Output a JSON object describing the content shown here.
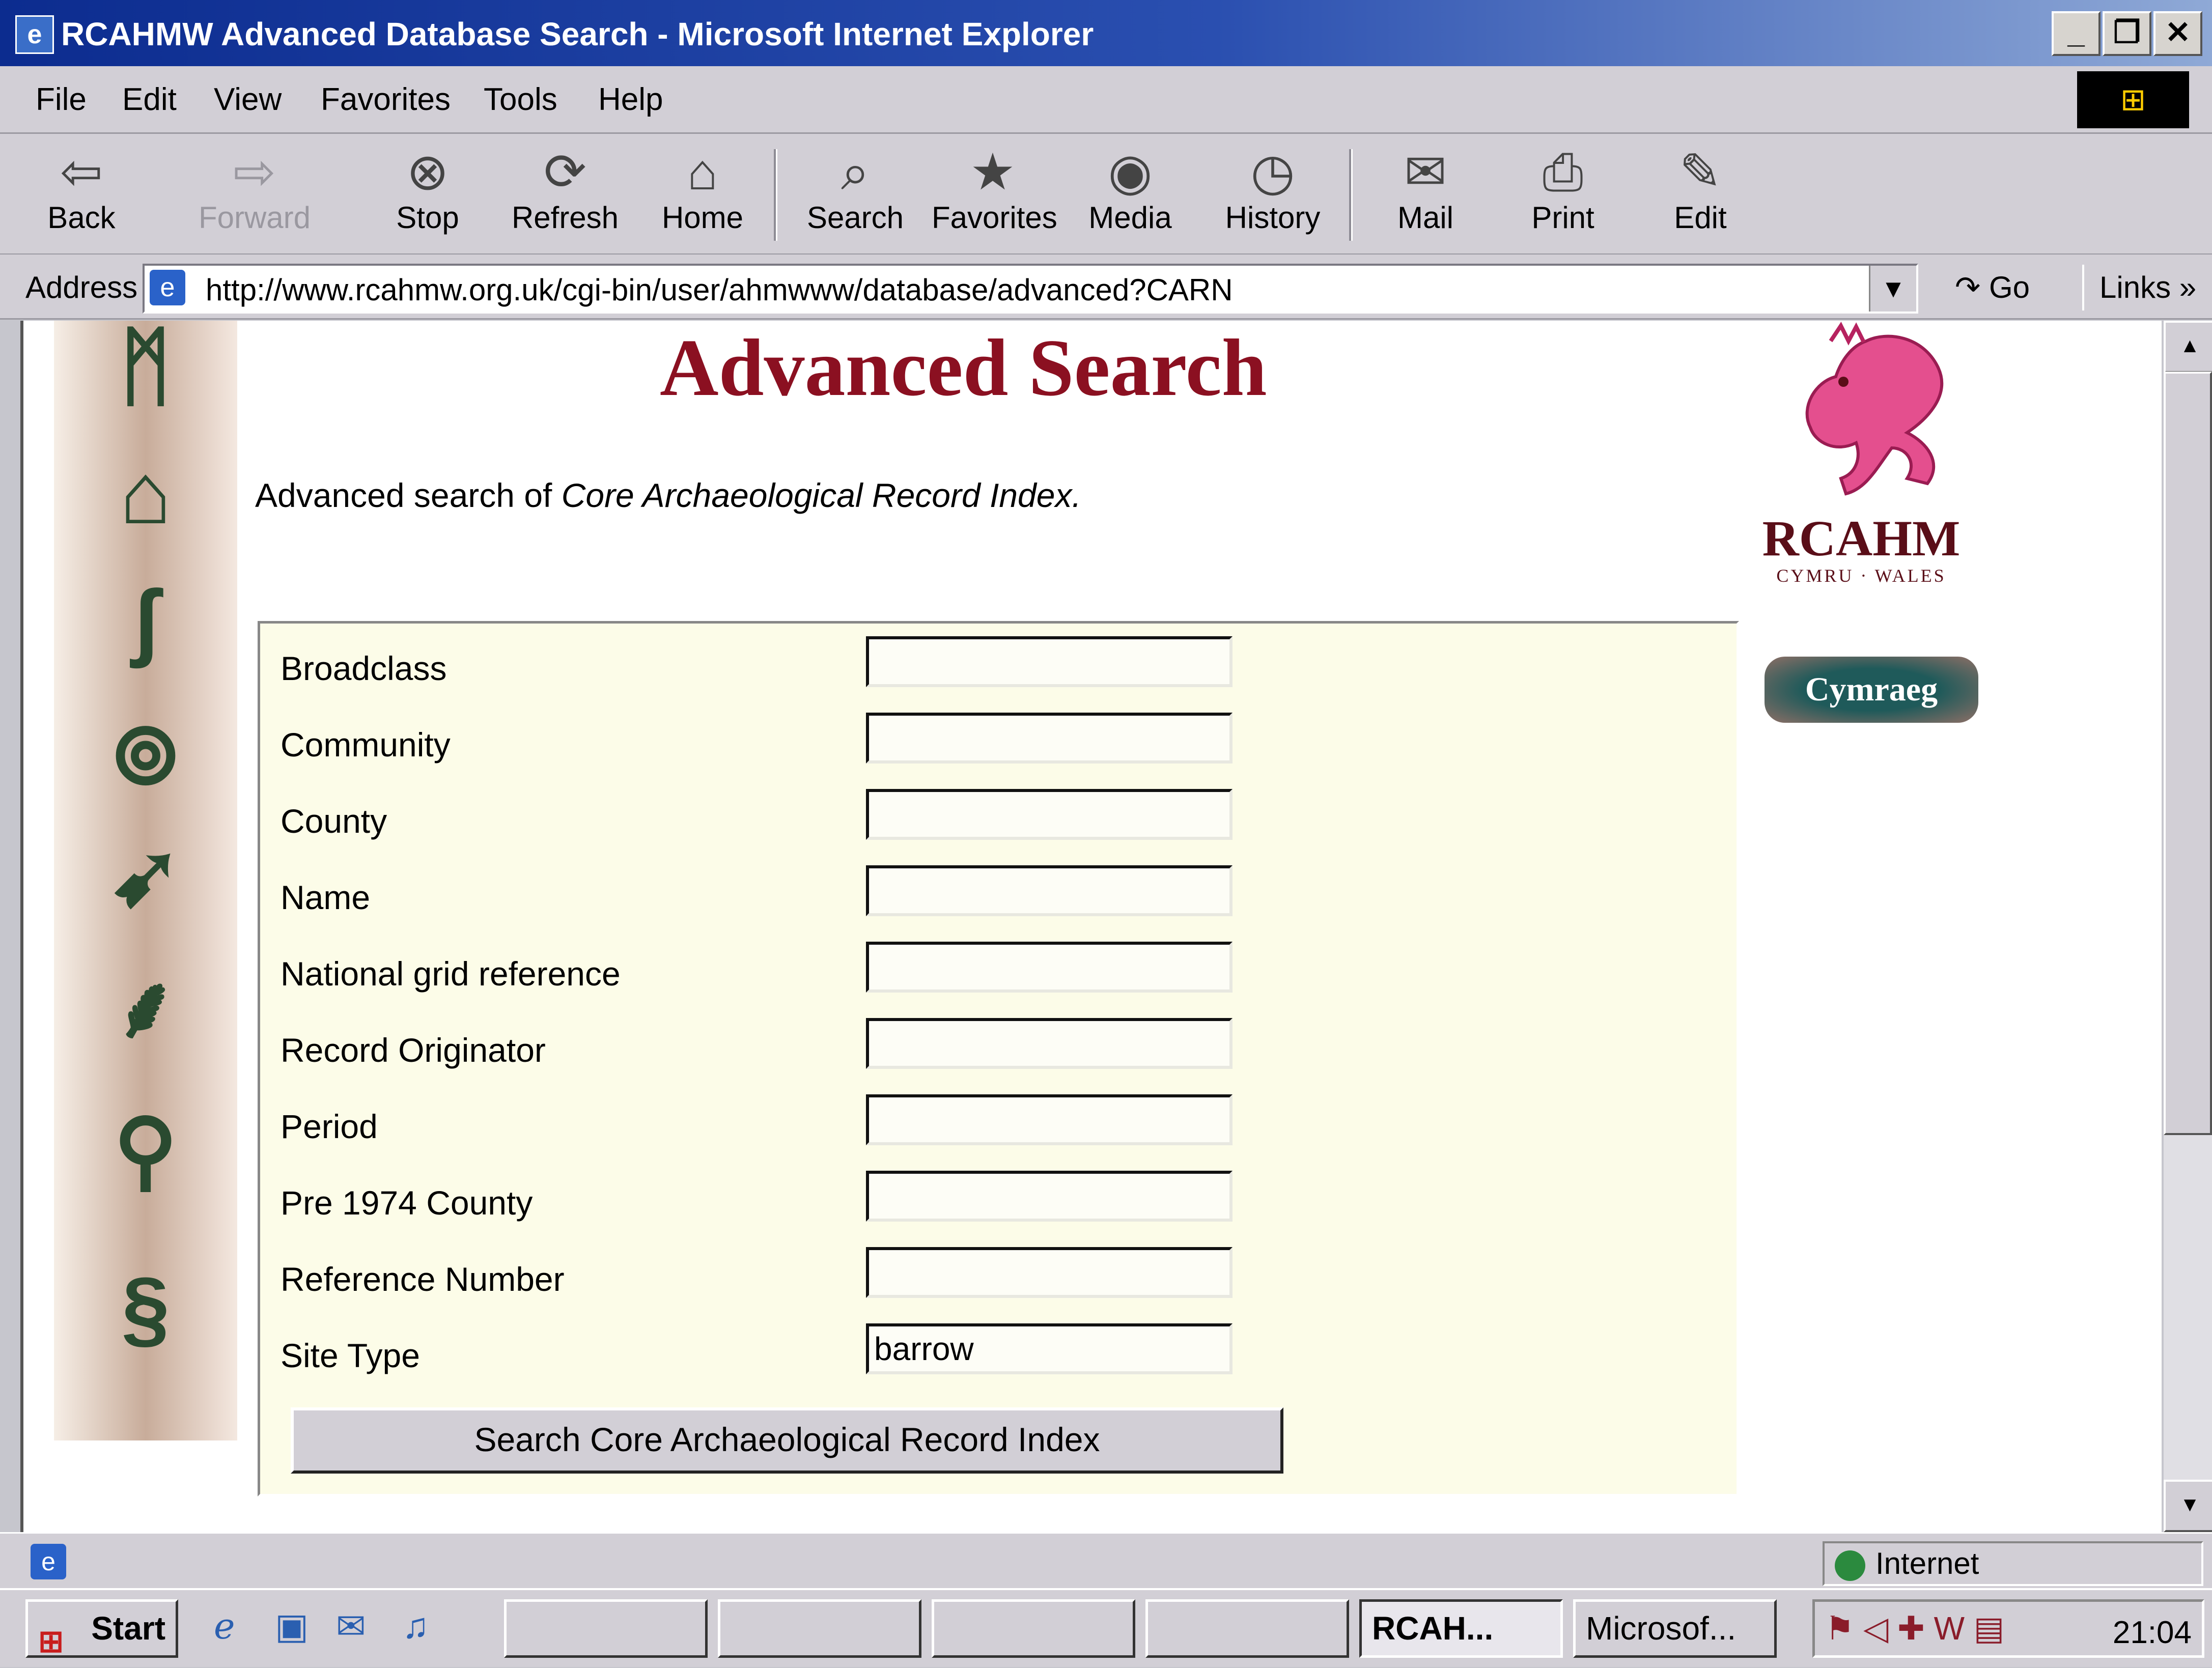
{
  "window": {
    "title": "RCAHMW Advanced Database Search - Microsoft Internet Explorer",
    "controls": [
      "_",
      "❐",
      "✕"
    ]
  },
  "menu": [
    "File",
    "Edit",
    "View",
    "Favorites",
    "Tools",
    "Help"
  ],
  "toolbar": [
    {
      "label": "Back",
      "icon": "back-arrow-icon",
      "glyph": "⇦"
    },
    {
      "label": "Forward",
      "icon": "forward-arrow-icon",
      "glyph": "⇨"
    },
    {
      "label": "Stop",
      "icon": "stop-icon",
      "glyph": "⊗"
    },
    {
      "label": "Refresh",
      "icon": "refresh-icon",
      "glyph": "⟳"
    },
    {
      "label": "Home",
      "icon": "home-icon",
      "glyph": "⌂"
    },
    {
      "label": "Search",
      "icon": "search-icon",
      "glyph": "⌕"
    },
    {
      "label": "Favorites",
      "icon": "favorites-icon",
      "glyph": "★"
    },
    {
      "label": "Media",
      "icon": "media-icon",
      "glyph": "◉"
    },
    {
      "label": "History",
      "icon": "history-icon",
      "glyph": "◷"
    },
    {
      "label": "Mail",
      "icon": "mail-icon",
      "glyph": "✉"
    },
    {
      "label": "Print",
      "icon": "print-icon",
      "glyph": "⎙"
    },
    {
      "label": "Edit",
      "icon": "edit-icon",
      "glyph": "✎"
    }
  ],
  "address": {
    "label": "Address",
    "url": "http://www.rcahmw.org.uk/cgi-bin/user/ahmwww/database/advanced?CARN",
    "go": "Go",
    "links": "Links"
  },
  "page": {
    "title": "Advanced Search",
    "subtitle_prefix": "Advanced search of ",
    "subtitle_italic": "Core Archaeological Record Index.",
    "logo_text": "RCAHM",
    "logo_subtext": "CYMRU · WALES",
    "language_button": "Cymraeg",
    "fields": [
      {
        "label": "Broadclass",
        "value": ""
      },
      {
        "label": "Community",
        "value": ""
      },
      {
        "label": "County",
        "value": ""
      },
      {
        "label": "Name",
        "value": ""
      },
      {
        "label": "National grid reference",
        "value": ""
      },
      {
        "label": "Record Originator",
        "value": ""
      },
      {
        "label": "Period",
        "value": ""
      },
      {
        "label": "Pre 1974 County",
        "value": ""
      },
      {
        "label": "Reference Number",
        "value": ""
      },
      {
        "label": "Site Type",
        "value": "barrow"
      }
    ],
    "submit_label": "Search Core Archaeological Record Index"
  },
  "status": {
    "zone": "Internet"
  },
  "taskbar": {
    "start": "Start",
    "tasks": [
      {
        "label": "",
        "active": false
      },
      {
        "label": "",
        "active": false
      },
      {
        "label": "",
        "active": false
      },
      {
        "label": "",
        "active": false
      },
      {
        "label": "RCAH...",
        "active": true
      },
      {
        "label": "Microsof...",
        "active": false
      }
    ],
    "clock": "21:04"
  }
}
